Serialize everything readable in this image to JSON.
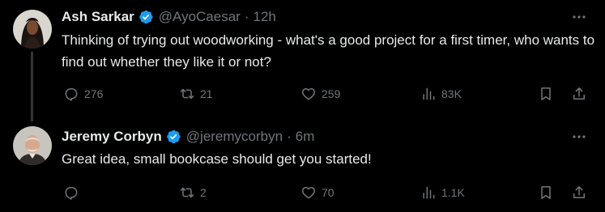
{
  "tweets": [
    {
      "author_name": "Ash Sarkar",
      "handle": "@AyoCaesar",
      "separator": "·",
      "time": "12h",
      "text": "Thinking of trying out woodworking - what's a good project for a first timer, who wants to find out whether they like it or not?",
      "replies": "276",
      "reposts": "21",
      "likes": "259",
      "views": "83K"
    },
    {
      "author_name": "Jeremy Corbyn",
      "handle": "@jeremycorbyn",
      "separator": "·",
      "time": "6m",
      "text": "Great idea, small bookcase should get you started!",
      "replies": "",
      "reposts": "2",
      "likes": "70",
      "views": "1.1K"
    }
  ],
  "icons": {
    "verified": "verified-badge-icon",
    "more": "more-horizontal-icon",
    "reply": "reply-icon",
    "repost": "repost-icon",
    "like": "heart-icon",
    "views": "views-bar-chart-icon",
    "bookmark": "bookmark-icon",
    "share": "share-icon"
  },
  "colors": {
    "background": "#000000",
    "text_primary": "#e7e9ea",
    "text_secondary": "#71767b",
    "verified_blue": "#1d9bf0",
    "thread_line": "#333639"
  }
}
